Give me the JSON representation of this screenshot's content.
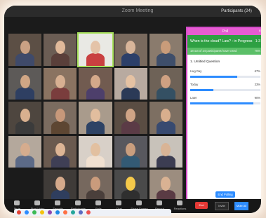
{
  "window": {
    "title": "Zoom Meeting",
    "participants_header": "Participants (24)"
  },
  "grid": {
    "tiles": [
      {
        "id": 1,
        "skin": "#caa184",
        "shirt": "#3f4a6a",
        "bg": "#5c4f45"
      },
      {
        "id": 2,
        "skin": "#e0b99a",
        "shirt": "#5a3f3a",
        "bg": "#6b5d54"
      },
      {
        "id": 3,
        "skin": "#e4c3a8",
        "shirt": "#c94040",
        "bg": "#e9e9e4",
        "active": true
      },
      {
        "id": 4,
        "skin": "#d8b59a",
        "shirt": "#2c3f69",
        "bg": "#796a5e"
      },
      {
        "id": 5,
        "skin": "#c99c7a",
        "shirt": "#3e4e6a",
        "bg": "#8a7b6d"
      },
      {
        "id": 6,
        "skin": "#cfa685",
        "shirt": "#2e3f62",
        "bg": "#5d5a58"
      },
      {
        "id": 7,
        "skin": "#d7b092",
        "shirt": "#7a3d3d",
        "bg": "#8a7361"
      },
      {
        "id": 8,
        "skin": "#d4a98a",
        "shirt": "#4d3f6b",
        "bg": "#715b50"
      },
      {
        "id": 9,
        "skin": "#e5c2a3",
        "shirt": "#2b3a57",
        "bg": "#b8aaa0"
      },
      {
        "id": 10,
        "skin": "#cfa182",
        "shirt": "#345063",
        "bg": "#6e6257"
      },
      {
        "id": 11,
        "skin": "#d8b08f",
        "shirt": "#3b3b3b",
        "bg": "#4e463f"
      },
      {
        "id": 12,
        "skin": "#c7987a",
        "shirt": "#5d4632",
        "bg": "#7b6c60"
      },
      {
        "id": 13,
        "skin": "#e1bd9e",
        "shirt": "#2e4365",
        "bg": "#a99b8c"
      },
      {
        "id": 14,
        "skin": "#cfa486",
        "shirt": "#5b3b46",
        "bg": "#5a4d43"
      },
      {
        "id": 15,
        "skin": "#d8ae8d",
        "shirt": "#384a70",
        "bg": "#7d6f62"
      },
      {
        "id": 16,
        "skin": "#d5ac8e",
        "shirt": "#5c6a87",
        "bg": "#b4a89c"
      },
      {
        "id": 17,
        "skin": "#ddb595",
        "shirt": "#3f3f55",
        "bg": "#6a5a4f"
      },
      {
        "id": 18,
        "skin": "#e2c0a0",
        "shirt": "#f0e0d0",
        "bg": "#d8d0c8"
      },
      {
        "id": 19,
        "skin": "#c99e7e",
        "shirt": "#335a74",
        "bg": "#58585e"
      },
      {
        "id": 20,
        "skin": "#d9b496",
        "shirt": "#3c3d52",
        "bg": "#c8c2ba"
      },
      {
        "id": 21,
        "blank": true
      },
      {
        "id": 22,
        "skin": "#d4a98b",
        "shirt": "#2f3e5e",
        "bg": "#3f3b38"
      },
      {
        "id": 23,
        "skin": "#c99b7c",
        "shirt": "#4a3f3b",
        "bg": "#76685e"
      },
      {
        "id": 24,
        "skin": "#f4c94a",
        "shirt": "#2f2f2f",
        "bg": "#4a4a4a",
        "emoji": true
      },
      {
        "id": 25,
        "skin": "#d9b293",
        "shirt": "#5a3b44",
        "bg": "#9c8d7f"
      }
    ]
  },
  "poll": {
    "window_title": "Poll",
    "close_icon": "×",
    "status_title": "When is the cloud? Law? : in Progress",
    "count": "1:3",
    "sub_left": "18 out of 24 participants have voted",
    "sub_right": "75%",
    "question": "1. Untitled Question",
    "options": [
      {
        "label": "Hug Day",
        "percent": "67%",
        "fraction": 0.67
      },
      {
        "label": "Today",
        "percent": "33%",
        "fraction": 0.33
      },
      {
        "label": "Later",
        "percent": "90%",
        "fraction": 0.9
      }
    ],
    "end_button": "End Polling"
  },
  "toolbar": {
    "items": [
      {
        "label": "Mute",
        "icon": "mic-icon"
      },
      {
        "label": "Start Video",
        "icon": "video-icon"
      },
      {
        "label": "Security",
        "icon": "shield-icon"
      },
      {
        "label": "Participants",
        "icon": "participants-icon"
      },
      {
        "label": "Polls",
        "icon": "poll-icon"
      },
      {
        "label": "Chat",
        "icon": "chat-icon"
      },
      {
        "label": "Share Screen",
        "icon": "share-icon"
      },
      {
        "label": "Record",
        "icon": "record-icon"
      },
      {
        "label": "Reactions",
        "icon": "reactions-icon"
      }
    ],
    "end_label": "End",
    "btn_a": "Invite",
    "btn_b": "Mute All"
  },
  "colors": {
    "poll_border": "#d44cc8",
    "poll_header": "#e75cd2",
    "poll_status": "#2ea043",
    "accent_blue": "#2d8cff",
    "end_red": "#e53935",
    "os_dots": [
      "#e34234",
      "#2d8cff",
      "#3cba54",
      "#f4c20d",
      "#8e44ad",
      "#1e88e5",
      "#ff7043",
      "#26a69a",
      "#5c6bc0",
      "#ef5350"
    ]
  }
}
